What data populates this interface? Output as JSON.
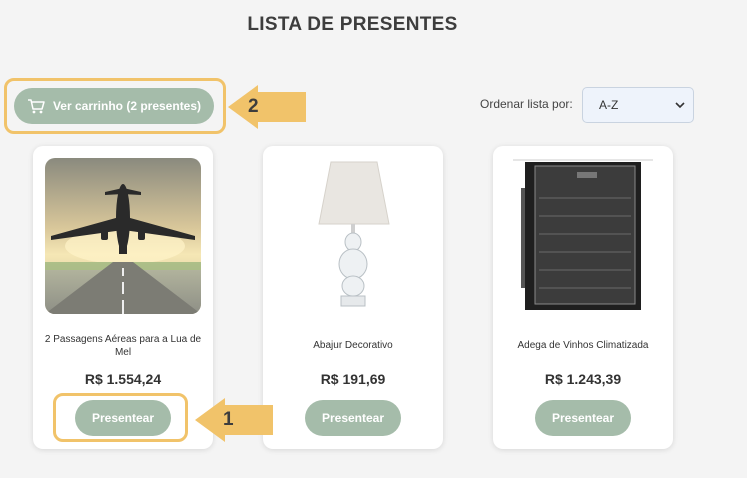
{
  "page": {
    "title": "LISTA DE PRESENTES"
  },
  "cart": {
    "label": "Ver carrinho (2 presentes)",
    "icon": "cart-icon"
  },
  "sort": {
    "label": "Ordenar lista por:",
    "selected": "A-Z"
  },
  "annotations": {
    "step1": "1",
    "step2": "2",
    "color": "#f1c36a"
  },
  "products": [
    {
      "name": "2 Passagens Aéreas para a Lua de Mel",
      "price": "R$ 1.554,24",
      "button": "Presentear"
    },
    {
      "name": "Abajur Decorativo",
      "price": "R$ 191,69",
      "button": "Presentear"
    },
    {
      "name": "Adega de Vinhos Climatizada",
      "price": "R$ 1.243,39",
      "button": "Presentear"
    }
  ],
  "colors": {
    "accent": "#a5bcaa",
    "highlight": "#f1c36a",
    "background": "#f4f4f4"
  }
}
